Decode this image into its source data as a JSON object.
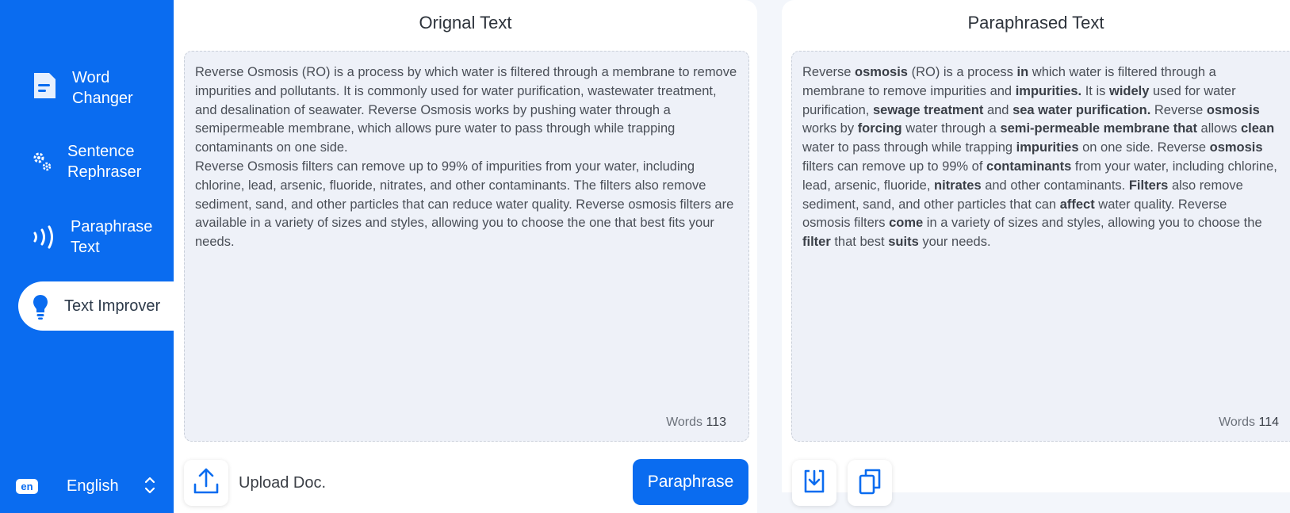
{
  "sidebar": {
    "items": [
      {
        "line1": "Word",
        "line2": "Changer",
        "icon": "document-icon"
      },
      {
        "line1": "Sentence",
        "line2": "Rephraser",
        "icon": "gears-icon"
      },
      {
        "line1": "Paraphrase",
        "line2": "Text",
        "icon": "sound-waves-icon"
      },
      {
        "label": "Text Improver",
        "icon": "lightbulb-icon",
        "active": true
      }
    ],
    "language": {
      "code": "en",
      "label": "English"
    }
  },
  "original": {
    "title": "Orignal Text",
    "paragraph1": "Reverse Osmosis (RO) is a process by which water is filtered through a membrane to remove impurities and pollutants. It is commonly used for water purification, wastewater treatment, and desalination of seawater. Reverse Osmosis works by pushing water through a semipermeable membrane, which allows pure water to pass through while trapping contaminants on one side.",
    "paragraph2": "Reverse Osmosis filters can remove up to 99% of impurities from your water, including chlorine, lead, arsenic, fluoride, nitrates, and other contaminants. The filters also remove sediment, sand, and other particles that can reduce water quality. Reverse osmosis filters are available in a variety of sizes and styles, allowing you to choose the one that best fits your needs.",
    "word_label": "Words",
    "word_count": "113",
    "upload_label": "Upload Doc.",
    "paraphrase_button": "Paraphrase"
  },
  "paraphrased": {
    "title": "Paraphrased Text",
    "segments": [
      {
        "t": "Reverse "
      },
      {
        "t": "osmosis",
        "b": true
      },
      {
        "t": " (RO) is a process "
      },
      {
        "t": "in",
        "b": true
      },
      {
        "t": " which water is filtered through a membrane to remove impurities and "
      },
      {
        "t": "impurities.",
        "b": true
      },
      {
        "t": " It is "
      },
      {
        "t": "widely",
        "b": true
      },
      {
        "t": " used for water purification, "
      },
      {
        "t": "sewage treatment",
        "b": true
      },
      {
        "t": " and "
      },
      {
        "t": "sea water purification.",
        "b": true
      },
      {
        "t": " Reverse "
      },
      {
        "t": "osmosis",
        "b": true
      },
      {
        "t": " works by "
      },
      {
        "t": "forcing",
        "b": true
      },
      {
        "t": " water through a "
      },
      {
        "t": "semi-permeable membrane that",
        "b": true
      },
      {
        "t": " allows "
      },
      {
        "t": "clean",
        "b": true
      },
      {
        "t": " water to pass through while trapping "
      },
      {
        "t": "impurities",
        "b": true
      },
      {
        "t": " on one side. Reverse "
      },
      {
        "t": "osmosis",
        "b": true
      },
      {
        "t": " filters can remove up to 99% of "
      },
      {
        "t": "contaminants",
        "b": true
      },
      {
        "t": " from your water, including chlorine, lead, arsenic, fluoride, "
      },
      {
        "t": "nitrates",
        "b": true
      },
      {
        "t": " and other contaminants. "
      },
      {
        "t": "Filters",
        "b": true
      },
      {
        "t": " also remove sediment, sand, and other particles that can "
      },
      {
        "t": "affect",
        "b": true
      },
      {
        "t": " water quality. Reverse osmosis filters "
      },
      {
        "t": "come",
        "b": true
      },
      {
        "t": " in a variety of sizes and styles, allowing you to choose the "
      },
      {
        "t": "filter",
        "b": true
      },
      {
        "t": " that best "
      },
      {
        "t": "suits",
        "b": true
      },
      {
        "t": " your needs."
      }
    ],
    "word_label": "Words",
    "word_count": "114"
  },
  "colors": {
    "accent": "#0a6cf0",
    "box_bg": "#eef1f8"
  }
}
